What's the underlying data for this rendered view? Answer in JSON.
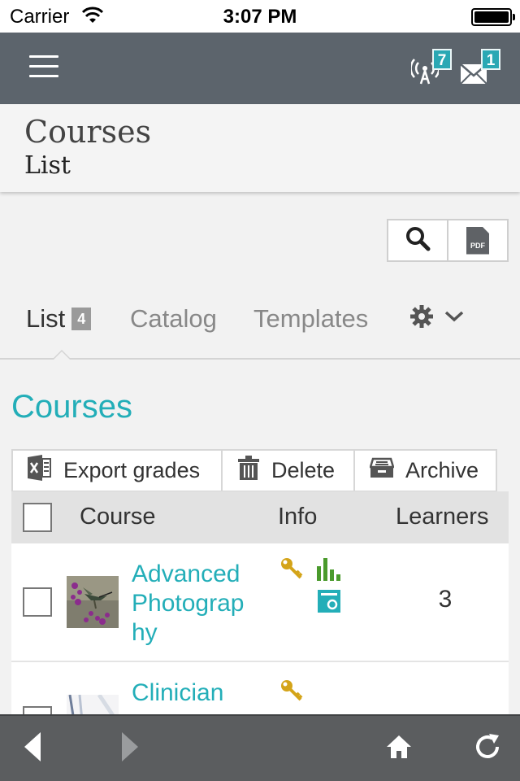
{
  "status_bar": {
    "carrier": "Carrier",
    "time": "3:07 PM"
  },
  "top_bar": {
    "notifications_count": "7",
    "messages_count": "1"
  },
  "heading": {
    "title": "Courses",
    "subtitle": "List"
  },
  "tabs": [
    {
      "label": "List",
      "count": "4",
      "active": true
    },
    {
      "label": "Catalog"
    },
    {
      "label": "Templates"
    }
  ],
  "section_title": "Courses",
  "actions": {
    "export": "Export grades",
    "delete": "Delete",
    "archive": "Archive"
  },
  "table": {
    "headers": {
      "course": "Course",
      "info": "Info",
      "learners": "Learners"
    },
    "rows": [
      {
        "course": "Advanced Photograp hy",
        "learners": "3",
        "icons": [
          "key-icon",
          "bar-chart-icon",
          "certificate-icon"
        ]
      },
      {
        "course": "Clinician",
        "learners": "",
        "icons": [
          "key-icon"
        ]
      }
    ]
  },
  "colors": {
    "accent": "#23aeb8",
    "top_bar": "#5c646c",
    "bottom_bar": "#5b5d5f",
    "key": "#d4a419",
    "chart": "#4a9a2c"
  }
}
